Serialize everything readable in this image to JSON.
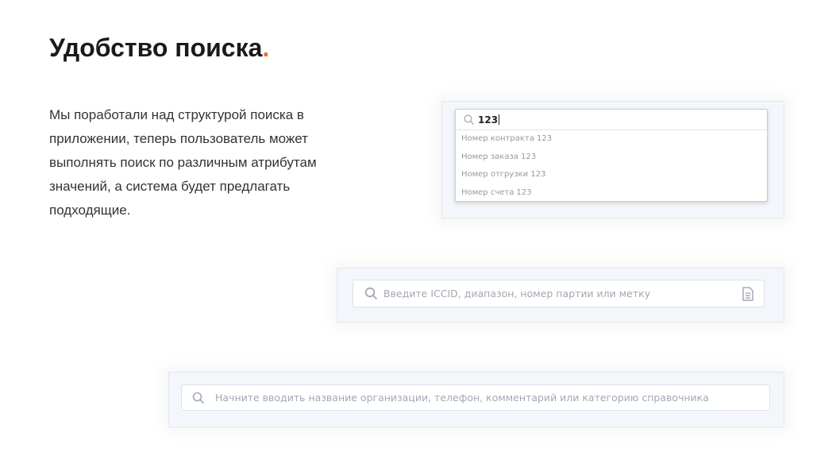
{
  "header": {
    "title": "Удобство поиска",
    "title_dot": "."
  },
  "description": "Мы поработали над структурой поиска в приложении, теперь пользователь может выполнять поиск по различным атрибутам значений, а система будет предлагать подходящие.",
  "search1": {
    "value": "123",
    "suggestions": [
      {
        "label": "Номер контракта 123"
      },
      {
        "label": "Номер заказа 123"
      },
      {
        "label": "Номер отгрузки 123"
      },
      {
        "label": "Номер счета 123"
      }
    ]
  },
  "search2": {
    "placeholder": "Введите ICCID, диапазон, номер партии или метку"
  },
  "search3": {
    "placeholder": "Начните вводить название организации, телефон, комментарий или категорию справочника"
  },
  "colors": {
    "accent": "#f26a2e",
    "panel": "#f3f6fa"
  }
}
